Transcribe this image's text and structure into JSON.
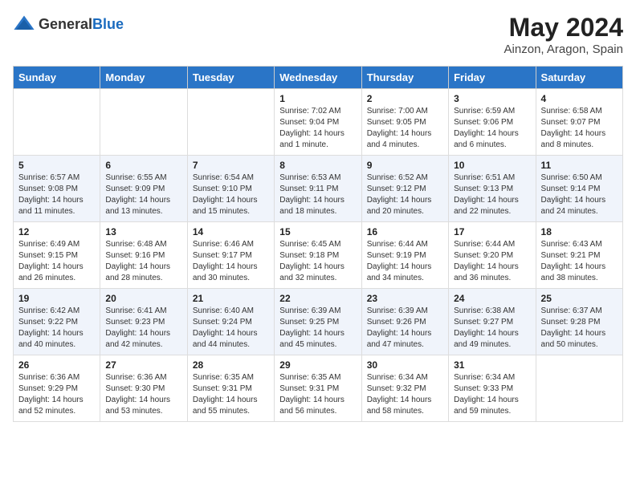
{
  "logo": {
    "general": "General",
    "blue": "Blue"
  },
  "title": {
    "month_year": "May 2024",
    "location": "Ainzon, Aragon, Spain"
  },
  "days_of_week": [
    "Sunday",
    "Monday",
    "Tuesday",
    "Wednesday",
    "Thursday",
    "Friday",
    "Saturday"
  ],
  "weeks": [
    [
      {
        "day": "",
        "info": ""
      },
      {
        "day": "",
        "info": ""
      },
      {
        "day": "",
        "info": ""
      },
      {
        "day": "1",
        "info": "Sunrise: 7:02 AM\nSunset: 9:04 PM\nDaylight: 14 hours\nand 1 minute."
      },
      {
        "day": "2",
        "info": "Sunrise: 7:00 AM\nSunset: 9:05 PM\nDaylight: 14 hours\nand 4 minutes."
      },
      {
        "day": "3",
        "info": "Sunrise: 6:59 AM\nSunset: 9:06 PM\nDaylight: 14 hours\nand 6 minutes."
      },
      {
        "day": "4",
        "info": "Sunrise: 6:58 AM\nSunset: 9:07 PM\nDaylight: 14 hours\nand 8 minutes."
      }
    ],
    [
      {
        "day": "5",
        "info": "Sunrise: 6:57 AM\nSunset: 9:08 PM\nDaylight: 14 hours\nand 11 minutes."
      },
      {
        "day": "6",
        "info": "Sunrise: 6:55 AM\nSunset: 9:09 PM\nDaylight: 14 hours\nand 13 minutes."
      },
      {
        "day": "7",
        "info": "Sunrise: 6:54 AM\nSunset: 9:10 PM\nDaylight: 14 hours\nand 15 minutes."
      },
      {
        "day": "8",
        "info": "Sunrise: 6:53 AM\nSunset: 9:11 PM\nDaylight: 14 hours\nand 18 minutes."
      },
      {
        "day": "9",
        "info": "Sunrise: 6:52 AM\nSunset: 9:12 PM\nDaylight: 14 hours\nand 20 minutes."
      },
      {
        "day": "10",
        "info": "Sunrise: 6:51 AM\nSunset: 9:13 PM\nDaylight: 14 hours\nand 22 minutes."
      },
      {
        "day": "11",
        "info": "Sunrise: 6:50 AM\nSunset: 9:14 PM\nDaylight: 14 hours\nand 24 minutes."
      }
    ],
    [
      {
        "day": "12",
        "info": "Sunrise: 6:49 AM\nSunset: 9:15 PM\nDaylight: 14 hours\nand 26 minutes."
      },
      {
        "day": "13",
        "info": "Sunrise: 6:48 AM\nSunset: 9:16 PM\nDaylight: 14 hours\nand 28 minutes."
      },
      {
        "day": "14",
        "info": "Sunrise: 6:46 AM\nSunset: 9:17 PM\nDaylight: 14 hours\nand 30 minutes."
      },
      {
        "day": "15",
        "info": "Sunrise: 6:45 AM\nSunset: 9:18 PM\nDaylight: 14 hours\nand 32 minutes."
      },
      {
        "day": "16",
        "info": "Sunrise: 6:44 AM\nSunset: 9:19 PM\nDaylight: 14 hours\nand 34 minutes."
      },
      {
        "day": "17",
        "info": "Sunrise: 6:44 AM\nSunset: 9:20 PM\nDaylight: 14 hours\nand 36 minutes."
      },
      {
        "day": "18",
        "info": "Sunrise: 6:43 AM\nSunset: 9:21 PM\nDaylight: 14 hours\nand 38 minutes."
      }
    ],
    [
      {
        "day": "19",
        "info": "Sunrise: 6:42 AM\nSunset: 9:22 PM\nDaylight: 14 hours\nand 40 minutes."
      },
      {
        "day": "20",
        "info": "Sunrise: 6:41 AM\nSunset: 9:23 PM\nDaylight: 14 hours\nand 42 minutes."
      },
      {
        "day": "21",
        "info": "Sunrise: 6:40 AM\nSunset: 9:24 PM\nDaylight: 14 hours\nand 44 minutes."
      },
      {
        "day": "22",
        "info": "Sunrise: 6:39 AM\nSunset: 9:25 PM\nDaylight: 14 hours\nand 45 minutes."
      },
      {
        "day": "23",
        "info": "Sunrise: 6:39 AM\nSunset: 9:26 PM\nDaylight: 14 hours\nand 47 minutes."
      },
      {
        "day": "24",
        "info": "Sunrise: 6:38 AM\nSunset: 9:27 PM\nDaylight: 14 hours\nand 49 minutes."
      },
      {
        "day": "25",
        "info": "Sunrise: 6:37 AM\nSunset: 9:28 PM\nDaylight: 14 hours\nand 50 minutes."
      }
    ],
    [
      {
        "day": "26",
        "info": "Sunrise: 6:36 AM\nSunset: 9:29 PM\nDaylight: 14 hours\nand 52 minutes."
      },
      {
        "day": "27",
        "info": "Sunrise: 6:36 AM\nSunset: 9:30 PM\nDaylight: 14 hours\nand 53 minutes."
      },
      {
        "day": "28",
        "info": "Sunrise: 6:35 AM\nSunset: 9:31 PM\nDaylight: 14 hours\nand 55 minutes."
      },
      {
        "day": "29",
        "info": "Sunrise: 6:35 AM\nSunset: 9:31 PM\nDaylight: 14 hours\nand 56 minutes."
      },
      {
        "day": "30",
        "info": "Sunrise: 6:34 AM\nSunset: 9:32 PM\nDaylight: 14 hours\nand 58 minutes."
      },
      {
        "day": "31",
        "info": "Sunrise: 6:34 AM\nSunset: 9:33 PM\nDaylight: 14 hours\nand 59 minutes."
      },
      {
        "day": "",
        "info": ""
      }
    ]
  ]
}
